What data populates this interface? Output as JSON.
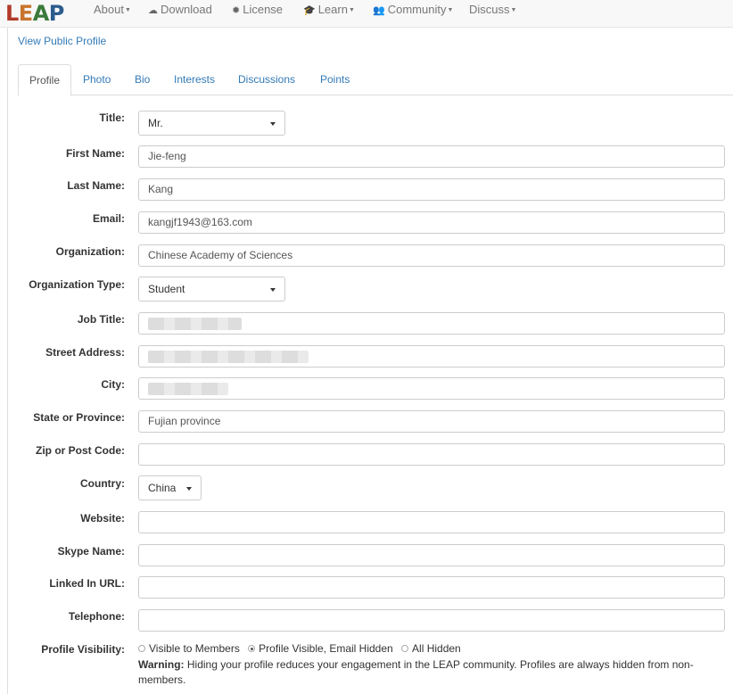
{
  "logo": [
    "L",
    "E",
    "A",
    "P"
  ],
  "nav": [
    {
      "label": "About",
      "icon": "",
      "dropdown": true
    },
    {
      "label": "Download",
      "icon": "cloud-download-icon",
      "dropdown": false
    },
    {
      "label": "License",
      "icon": "certificate-icon",
      "dropdown": false
    },
    {
      "label": "Learn",
      "icon": "graduation-cap-icon",
      "dropdown": true
    },
    {
      "label": "Community",
      "icon": "users-icon",
      "dropdown": true
    },
    {
      "label": "Discuss",
      "icon": "",
      "dropdown": true
    }
  ],
  "public_profile_link": "View Public Profile",
  "tabs": [
    "Profile",
    "Photo",
    "Bio",
    "Interests",
    "Discussions",
    "Points"
  ],
  "active_tab": "Profile",
  "form": {
    "title": {
      "label": "Title:",
      "value": "Mr."
    },
    "first_name": {
      "label": "First Name:",
      "value": "Jie-feng"
    },
    "last_name": {
      "label": "Last Name:",
      "value": "Kang"
    },
    "email": {
      "label": "Email:",
      "value": "kangjf1943@163.com"
    },
    "organization": {
      "label": "Organization:",
      "value": "Chinese Academy of Sciences"
    },
    "organization_type": {
      "label": "Organization Type:",
      "value": "Student"
    },
    "job_title": {
      "label": "Job Title:",
      "value": ""
    },
    "street_address": {
      "label": "Street Address:",
      "value": ""
    },
    "city": {
      "label": "City:",
      "value": ""
    },
    "state": {
      "label": "State or Province:",
      "value": "Fujian province"
    },
    "zip": {
      "label": "Zip or Post Code:",
      "value": ""
    },
    "country": {
      "label": "Country:",
      "value": "China"
    },
    "website": {
      "label": "Website:",
      "value": ""
    },
    "skype": {
      "label": "Skype Name:",
      "value": ""
    },
    "linkedin": {
      "label": "Linked In URL:",
      "value": ""
    },
    "telephone": {
      "label": "Telephone:",
      "value": ""
    },
    "visibility": {
      "label": "Profile Visibility:",
      "options": [
        "Visible to Members",
        "Profile Visible, Email Hidden",
        "All Hidden"
      ],
      "selected": "Profile Visible, Email Hidden"
    }
  },
  "warning": {
    "title": "Warning:",
    "text": " Hiding your profile reduces your engagement in the LEAP community. Profiles are always hidden from non-members."
  }
}
